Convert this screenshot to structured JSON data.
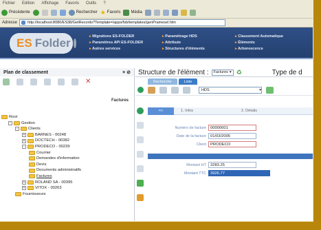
{
  "browser": {
    "menu": [
      "Fichier",
      "Edition",
      "Affichage",
      "Favoris",
      "Outils",
      "?"
    ],
    "toolbar": {
      "back": "Précédente",
      "search": "Rechercher",
      "favorites": "Favoris",
      "media": "Média"
    },
    "address_label": "Adresse",
    "address_value": "http://localhost:8080/ES38/GetRecords?Template=/apps/fsb/templates/genPramesel.htm"
  },
  "banner": {
    "logo_es": "ES",
    "logo_folder": "Folder",
    "menu": [
      [
        "Migrations ES-FOLDER",
        "Paramètres API ES-FOLDER",
        "Autres services"
      ],
      [
        "Paramétrage HDS",
        "Attribute",
        "Structures d'éléments"
      ],
      [
        "Classement Automatique",
        "Éléments",
        "Arborescence"
      ]
    ]
  },
  "sidebar": {
    "title": "Plan de classement",
    "close": "× ⊘",
    "right_label": "Factures",
    "tree": [
      {
        "label": "Root",
        "level": 0,
        "toggle": "",
        "selected": false
      },
      {
        "label": "Gestion",
        "level": 1,
        "toggle": "-",
        "selected": false
      },
      {
        "label": "Clients",
        "level": 2,
        "toggle": "-",
        "selected": false
      },
      {
        "label": "BARNES - 00248",
        "level": 3,
        "toggle": "+",
        "selected": false
      },
      {
        "label": "DOCTECH - 00382",
        "level": 3,
        "toggle": "+",
        "selected": false
      },
      {
        "label": "PRODECO - 00239",
        "level": 3,
        "toggle": "-",
        "selected": false
      },
      {
        "label": "Courrier",
        "level": 4,
        "toggle": "",
        "selected": false
      },
      {
        "label": "Demandes d'information",
        "level": 4,
        "toggle": "",
        "selected": false
      },
      {
        "label": "Devis",
        "level": 4,
        "toggle": "",
        "selected": false
      },
      {
        "label": "Documents administratifs",
        "level": 4,
        "toggle": "",
        "selected": false
      },
      {
        "label": "Factures",
        "level": 4,
        "toggle": "",
        "selected": true
      },
      {
        "label": "ROLAND SA - 00395",
        "level": 3,
        "toggle": "+",
        "selected": false
      },
      {
        "label": "VITOX - 00263",
        "level": 3,
        "toggle": "+",
        "selected": false
      },
      {
        "label": "Fournisseurs",
        "level": 2,
        "toggle": "",
        "selected": false
      }
    ]
  },
  "main": {
    "title": "Structure de l'élément :",
    "type_select": "Factures",
    "right_title": "Type de d",
    "tabs": [
      {
        "label": "Recherche",
        "active": false
      },
      {
        "label": "Liste",
        "active": true
      }
    ],
    "hds_value": "HDS",
    "steps": [
      "<<",
      "1. Infos",
      "2. Détails"
    ],
    "fields": [
      {
        "label": "Numéro de facture",
        "value": "00000001"
      },
      {
        "label": "Date de la facture",
        "value": "01/03/2005"
      },
      {
        "label": "Client",
        "value": "PRODECO"
      }
    ],
    "amount_fields": [
      {
        "label": "Montant HT",
        "value": "3283.25"
      },
      {
        "label": "Montant TTC",
        "value": "3926.77"
      }
    ]
  }
}
